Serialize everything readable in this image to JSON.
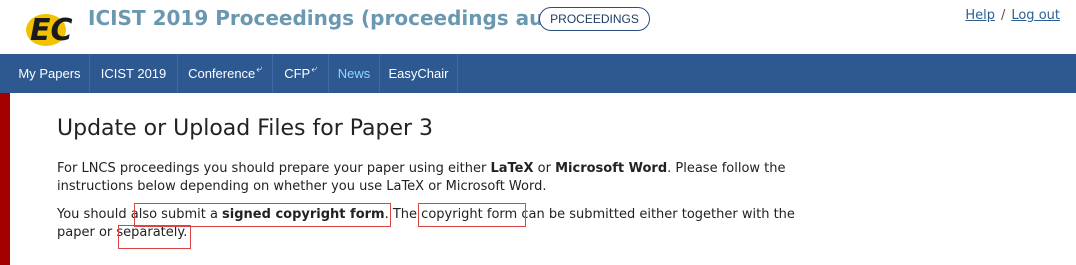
{
  "header": {
    "logo_text": "EC",
    "title": "ICIST 2019 Proceedings (proceedings author) -",
    "role_button": "PROCEEDINGS",
    "help_link": "Help",
    "separator": "/",
    "logout_link": "Log out"
  },
  "nav": {
    "items": [
      {
        "label": "My Papers",
        "external": false,
        "active": false
      },
      {
        "label": "ICIST 2019",
        "external": false,
        "active": false
      },
      {
        "label": "Conference",
        "external": true,
        "active": false
      },
      {
        "label": "CFP",
        "external": true,
        "active": false
      },
      {
        "label": "News",
        "external": false,
        "active": true
      },
      {
        "label": "EasyChair",
        "external": false,
        "active": false
      }
    ]
  },
  "main": {
    "title": "Update or Upload Files for Paper 3",
    "para1": {
      "t1": "For LNCS proceedings you should prepare your paper using either ",
      "b1": "LaTeX",
      "t2": " or ",
      "b2": "Microsoft Word",
      "t3": ". Please follow the instructions below depending on whether you use LaTeX or Microsoft Word."
    },
    "para2": {
      "t1": "You should also submit a ",
      "b1": "signed copyright form",
      "t2": ". The ",
      "link": "copyright form",
      "t3": " can be submitted either together with the paper or separately."
    }
  },
  "colors": {
    "nav_bg": "#2d5890",
    "nav_active": "#8ed7ff",
    "title_color": "#6a98b0",
    "left_accent": "#a40000",
    "highlight_border": "#d94545"
  }
}
